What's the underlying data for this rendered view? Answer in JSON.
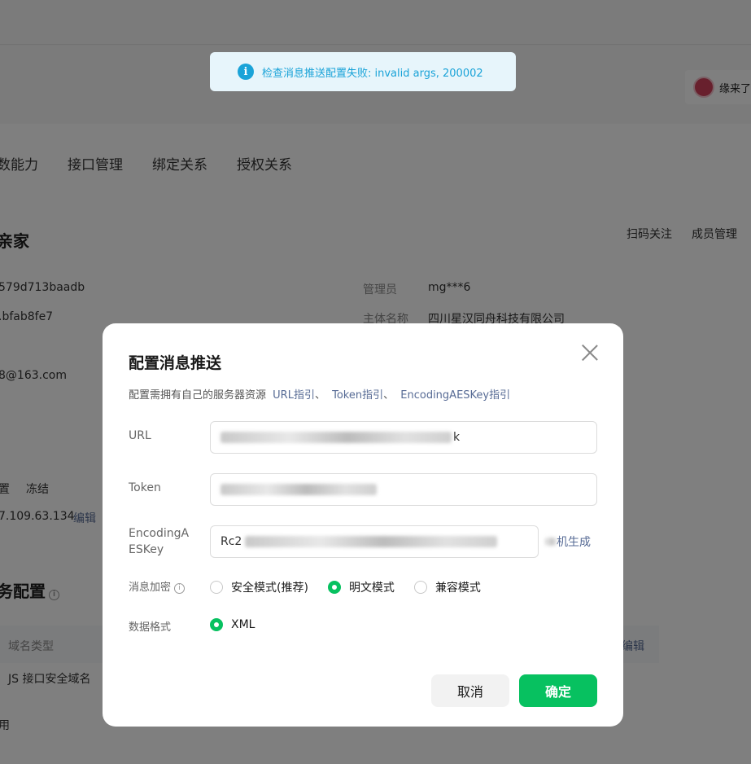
{
  "background": {
    "user_name": "缘来了",
    "tabs": [
      "数能力",
      "接口管理",
      "绑定关系",
      "授权关系"
    ],
    "account_title": "亲家",
    "actions": [
      "扫码关注",
      "成员管理"
    ],
    "info": {
      "id_value": "579d713baadb",
      "secret_value": ".bfab8fe7",
      "email_value": "8@163.com",
      "admin_label": "管理员",
      "admin_value": "mg***6",
      "entity_label": "主体名称",
      "entity_value": "四川星汉同舟科技有限公司",
      "reset_label": "置",
      "freeze_label": "冻结",
      "ip_value": "7.109.63.134",
      "edit_label": "编辑"
    },
    "section_title": "务配置",
    "table_header": "域名类型",
    "table_edit": "编辑",
    "table_row": "JS 接口安全域名",
    "row_footer": "用"
  },
  "toast": {
    "message": "检查消息推送配置失败: invalid args, 200002",
    "color": "#1aa3d8"
  },
  "dialog": {
    "title": "配置消息推送",
    "description": "配置需拥有自己的服务器资源",
    "links": [
      "URL指引",
      "Token指引",
      "EncodingAESKey指引"
    ],
    "separator": "、",
    "url_label": "URL",
    "url_value_suffix": "k",
    "token_label": "Token",
    "aeskey_label_line1": "EncodingA",
    "aeskey_label_line2": "ESKey",
    "aeskey_value_prefix": "Rc2",
    "aeskey_generate": "机生成",
    "encrypt_label": "消息加密",
    "encrypt_options": [
      {
        "label": "安全模式(推荐)",
        "selected": false
      },
      {
        "label": "明文模式",
        "selected": true
      },
      {
        "label": "兼容模式",
        "selected": false
      }
    ],
    "format_label": "数据格式",
    "format_options": [
      {
        "label": "XML",
        "selected": true
      }
    ],
    "cancel_label": "取消",
    "confirm_label": "确定",
    "accent_color": "#07c160"
  }
}
